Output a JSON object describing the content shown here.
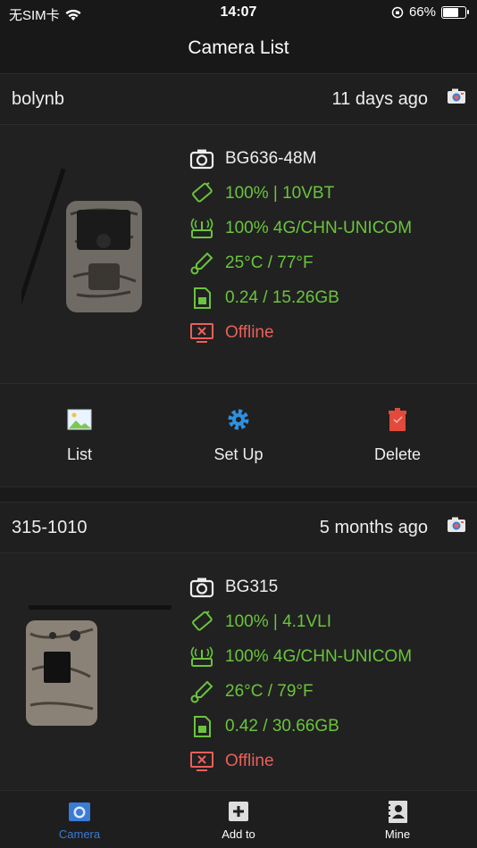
{
  "status_bar": {
    "carrier": "无SIM卡",
    "time": "14:07",
    "battery": "66%",
    "battery_level": 0.66
  },
  "nav": {
    "title": "Camera List"
  },
  "cameras": [
    {
      "name": "bolynb",
      "last_seen": "11 days ago",
      "model": "BG636-48M",
      "battery": "100% | 10VBT",
      "signal": "100% 4G/CHN-UNICOM",
      "temperature": "25°C / 77°F",
      "storage": "0.24 / 15.26GB",
      "status": "Offline"
    },
    {
      "name": "315-1010",
      "last_seen": "5 months ago",
      "model": "BG315",
      "battery": "100% | 4.1VLI",
      "signal": "100% 4G/CHN-UNICOM",
      "temperature": "26°C / 79°F",
      "storage": "0.42 / 30.66GB",
      "status": "Offline"
    }
  ],
  "actions": {
    "list": "List",
    "setup": "Set Up",
    "delete": "Delete"
  },
  "tabs": [
    {
      "label": "Camera",
      "icon": "camera-tab-icon"
    },
    {
      "label": "Add to",
      "icon": "add-icon"
    },
    {
      "label": "Mine",
      "icon": "contact-icon"
    }
  ],
  "colors": {
    "green": "#6ac43c",
    "offline": "#e9605a",
    "accent": "#3a7bd5",
    "setup_blue": "#2f8fe0"
  }
}
